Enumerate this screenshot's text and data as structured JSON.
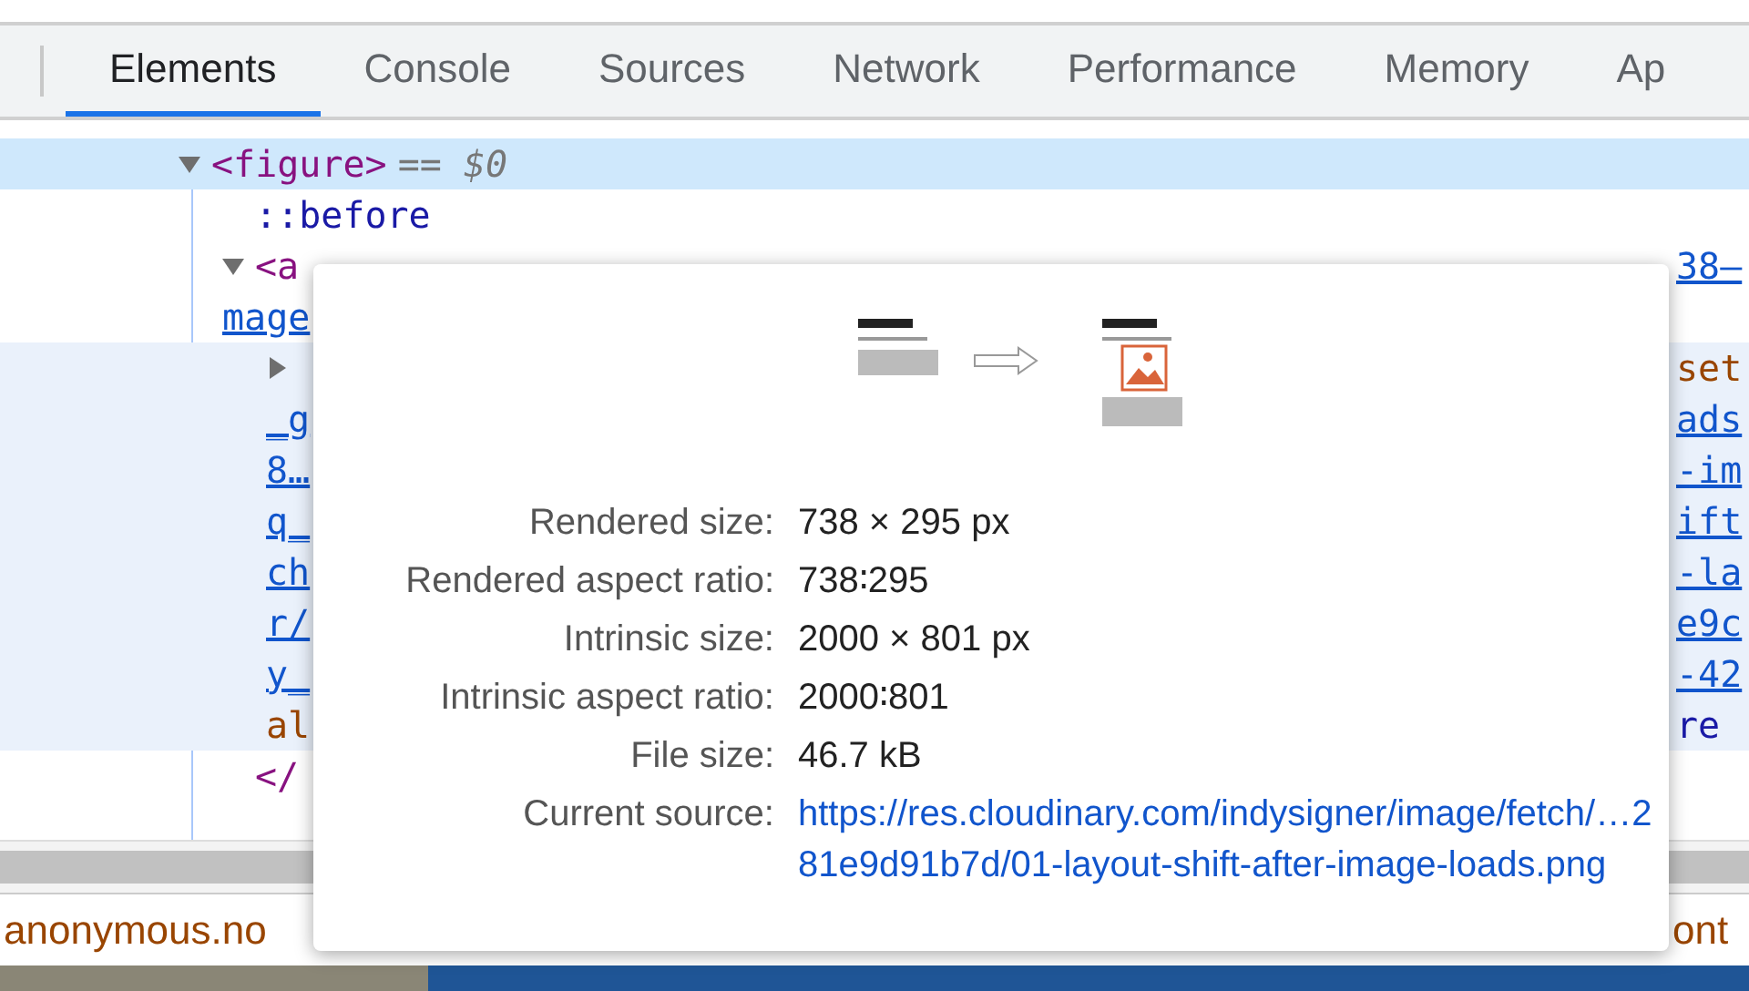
{
  "tabs": [
    {
      "label": "Elements",
      "selected": true
    },
    {
      "label": "Console",
      "selected": false
    },
    {
      "label": "Sources",
      "selected": false
    },
    {
      "label": "Network",
      "selected": false
    },
    {
      "label": "Performance",
      "selected": false
    },
    {
      "label": "Memory",
      "selected": false
    },
    {
      "label": "Ap",
      "selected": false
    }
  ],
  "dom_tree": [
    {
      "expanded": true,
      "selected": true,
      "hovered": false,
      "lines": [
        {
          "left": {
            "text": "<figure>",
            "kind": "tag"
          },
          "note": "== $0"
        }
      ],
      "children": [
        {
          "selected": false,
          "hovered": false,
          "lines": [
            {
              "left": {
                "text": "::before",
                "kind": "pseudo"
              }
            }
          ]
        },
        {
          "expanded": true,
          "selected": false,
          "hovered": false,
          "lines": [
            {
              "left": {
                "text": "<a",
                "kind": "tag"
              },
              "right": {
                "text": "38–",
                "kind": "link"
              }
            },
            {
              "left": {
                "text": "mage",
                "kind": "link"
              }
            }
          ],
          "closing": {
            "text": "</",
            "kind": "tag"
          },
          "children": [
            {
              "expanded": false,
              "selected": false,
              "hovered": true,
              "lines": [
                {
                  "right": {
                    "text": "set",
                    "kind": "attr"
                  }
                },
                {
                  "left": {
                    "text": "_g",
                    "kind": "link"
                  },
                  "right": {
                    "text": "ads",
                    "kind": "link"
                  }
                },
                {
                  "left": {
                    "text": "8…",
                    "kind": "link"
                  },
                  "right": {
                    "text": "-im",
                    "kind": "link"
                  }
                },
                {
                  "left": {
                    "text": "q_",
                    "kind": "link"
                  },
                  "right": {
                    "text": "ift",
                    "kind": "link"
                  }
                },
                {
                  "left": {
                    "text": "ch",
                    "kind": "link"
                  },
                  "right": {
                    "text": "-la",
                    "kind": "link"
                  }
                },
                {
                  "left": {
                    "text": "r/",
                    "kind": "link"
                  },
                  "right": {
                    "text": "e9c",
                    "kind": "link"
                  }
                },
                {
                  "left": {
                    "text": "y_",
                    "kind": "link"
                  },
                  "right": {
                    "text": "-42",
                    "kind": "link"
                  }
                },
                {
                  "left": {
                    "text": "al",
                    "kind": "attr"
                  },
                  "right": {
                    "text": "re",
                    "kind": "value"
                  }
                }
              ]
            }
          ]
        }
      ]
    }
  ],
  "tooltip": {
    "properties": [
      {
        "label": "Rendered size:",
        "value": "738 × 295 px"
      },
      {
        "label": "Rendered aspect ratio:",
        "value": "738∶295"
      },
      {
        "label": "Intrinsic size:",
        "value": "2000 × 801 px"
      },
      {
        "label": "Intrinsic aspect ratio:",
        "value": "2000∶801"
      },
      {
        "label": "File size:",
        "value": "46.7 kB"
      },
      {
        "label": "Current source:",
        "value": "https://res.cloudinary.com/indysigner/image/fetch/…281e9d91b7d/01-layout-shift-after-image-loads.png",
        "kind": "link"
      }
    ]
  },
  "console": {
    "left": "anonymous.no",
    "right": "ont"
  }
}
